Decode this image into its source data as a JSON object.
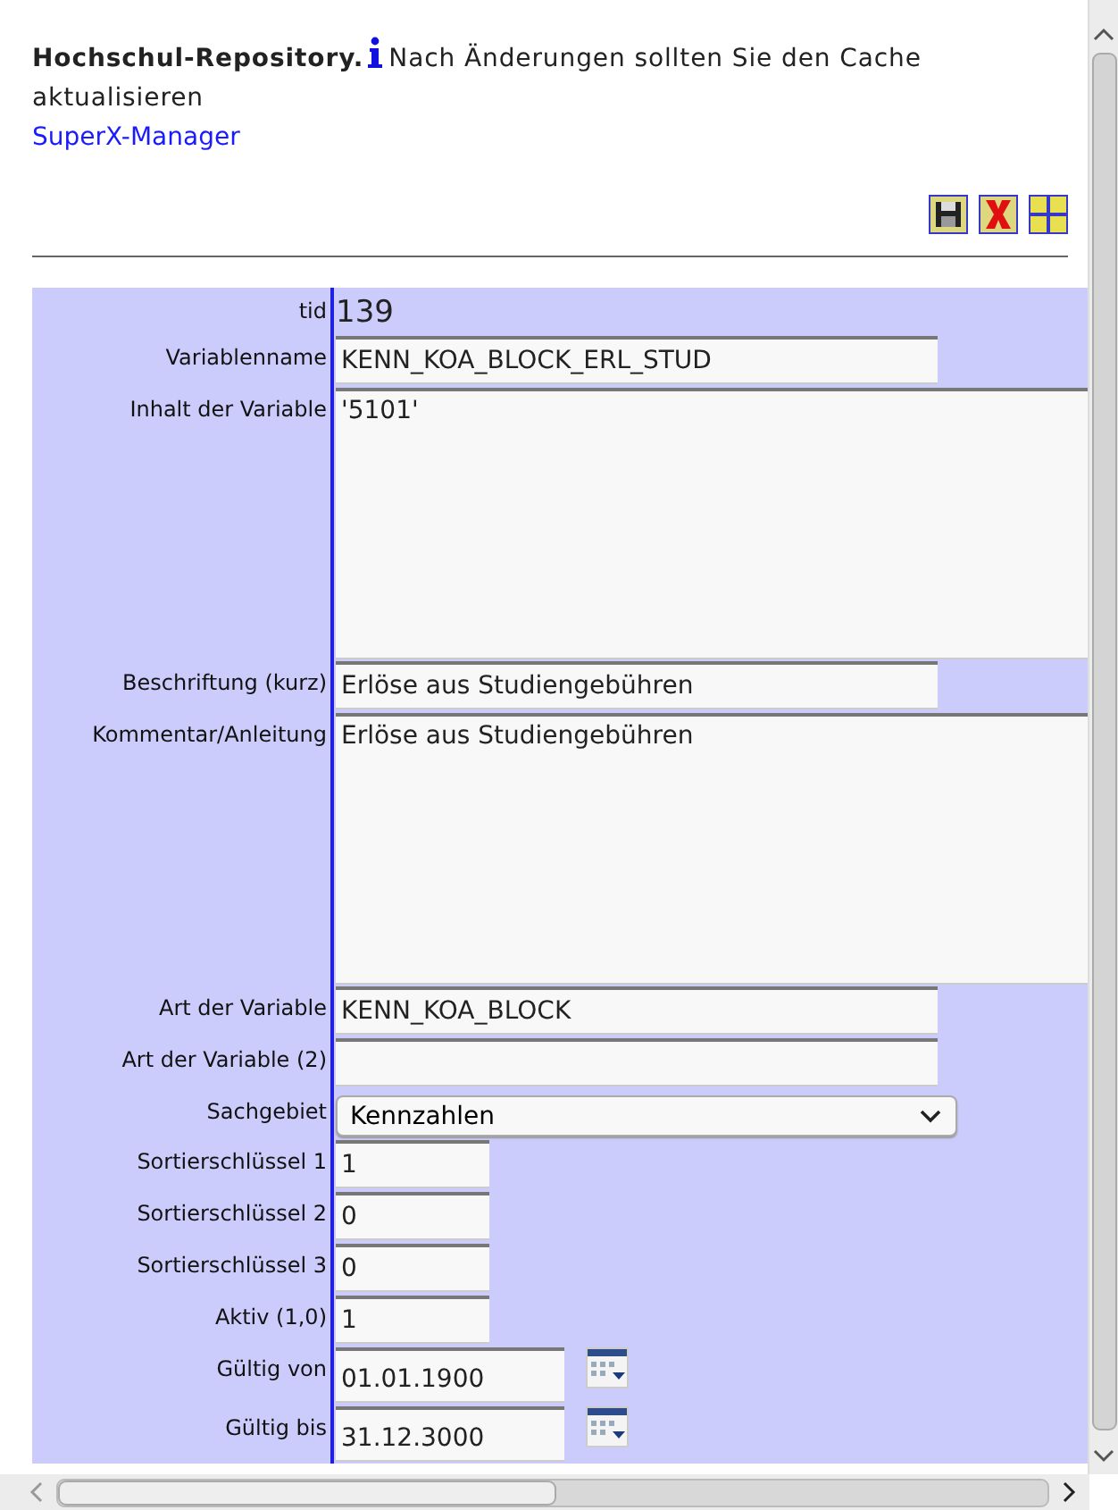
{
  "header": {
    "title": "Hochschul-Repository.",
    "notice": "Nach Änderungen sollten Sie den Cache aktualisieren",
    "link": "SuperX-Manager"
  },
  "toolbar": [
    {
      "kind": "save"
    },
    {
      "kind": "delete"
    },
    {
      "kind": "new"
    }
  ],
  "fields": [
    {
      "label": "tid",
      "kind": "static",
      "value": "139"
    },
    {
      "label": "Variablenname",
      "kind": "text",
      "value": "KENN_KOA_BLOCK_ERL_STUD"
    },
    {
      "label": "Inhalt der Variable",
      "kind": "textarea",
      "value": "'5101'"
    },
    {
      "label": "Beschriftung (kurz)",
      "kind": "text",
      "value": "Erlöse aus Studiengebühren"
    },
    {
      "label": "Kommentar/Anleitung",
      "kind": "textarea",
      "value": "Erlöse aus Studiengebühren"
    },
    {
      "label": "Art der Variable",
      "kind": "text",
      "value": "KENN_KOA_BLOCK"
    },
    {
      "label": "Art der Variable (2)",
      "kind": "text"
    },
    {
      "label": "Sachgebiet",
      "kind": "select",
      "value": "Kennzahlen"
    },
    {
      "label": "Sortierschlüssel 1",
      "kind": "short",
      "value": "1"
    },
    {
      "label": "Sortierschlüssel 2",
      "kind": "short",
      "value": "0"
    },
    {
      "label": "Sortierschlüssel 3",
      "kind": "short",
      "value": "0"
    },
    {
      "label": "Aktiv (1,0)",
      "kind": "short",
      "value": "1"
    },
    {
      "label": "Gültig von",
      "kind": "date",
      "value": "01.01.1900"
    },
    {
      "label": "Gültig bis",
      "kind": "date",
      "value": "31.12.3000"
    }
  ]
}
